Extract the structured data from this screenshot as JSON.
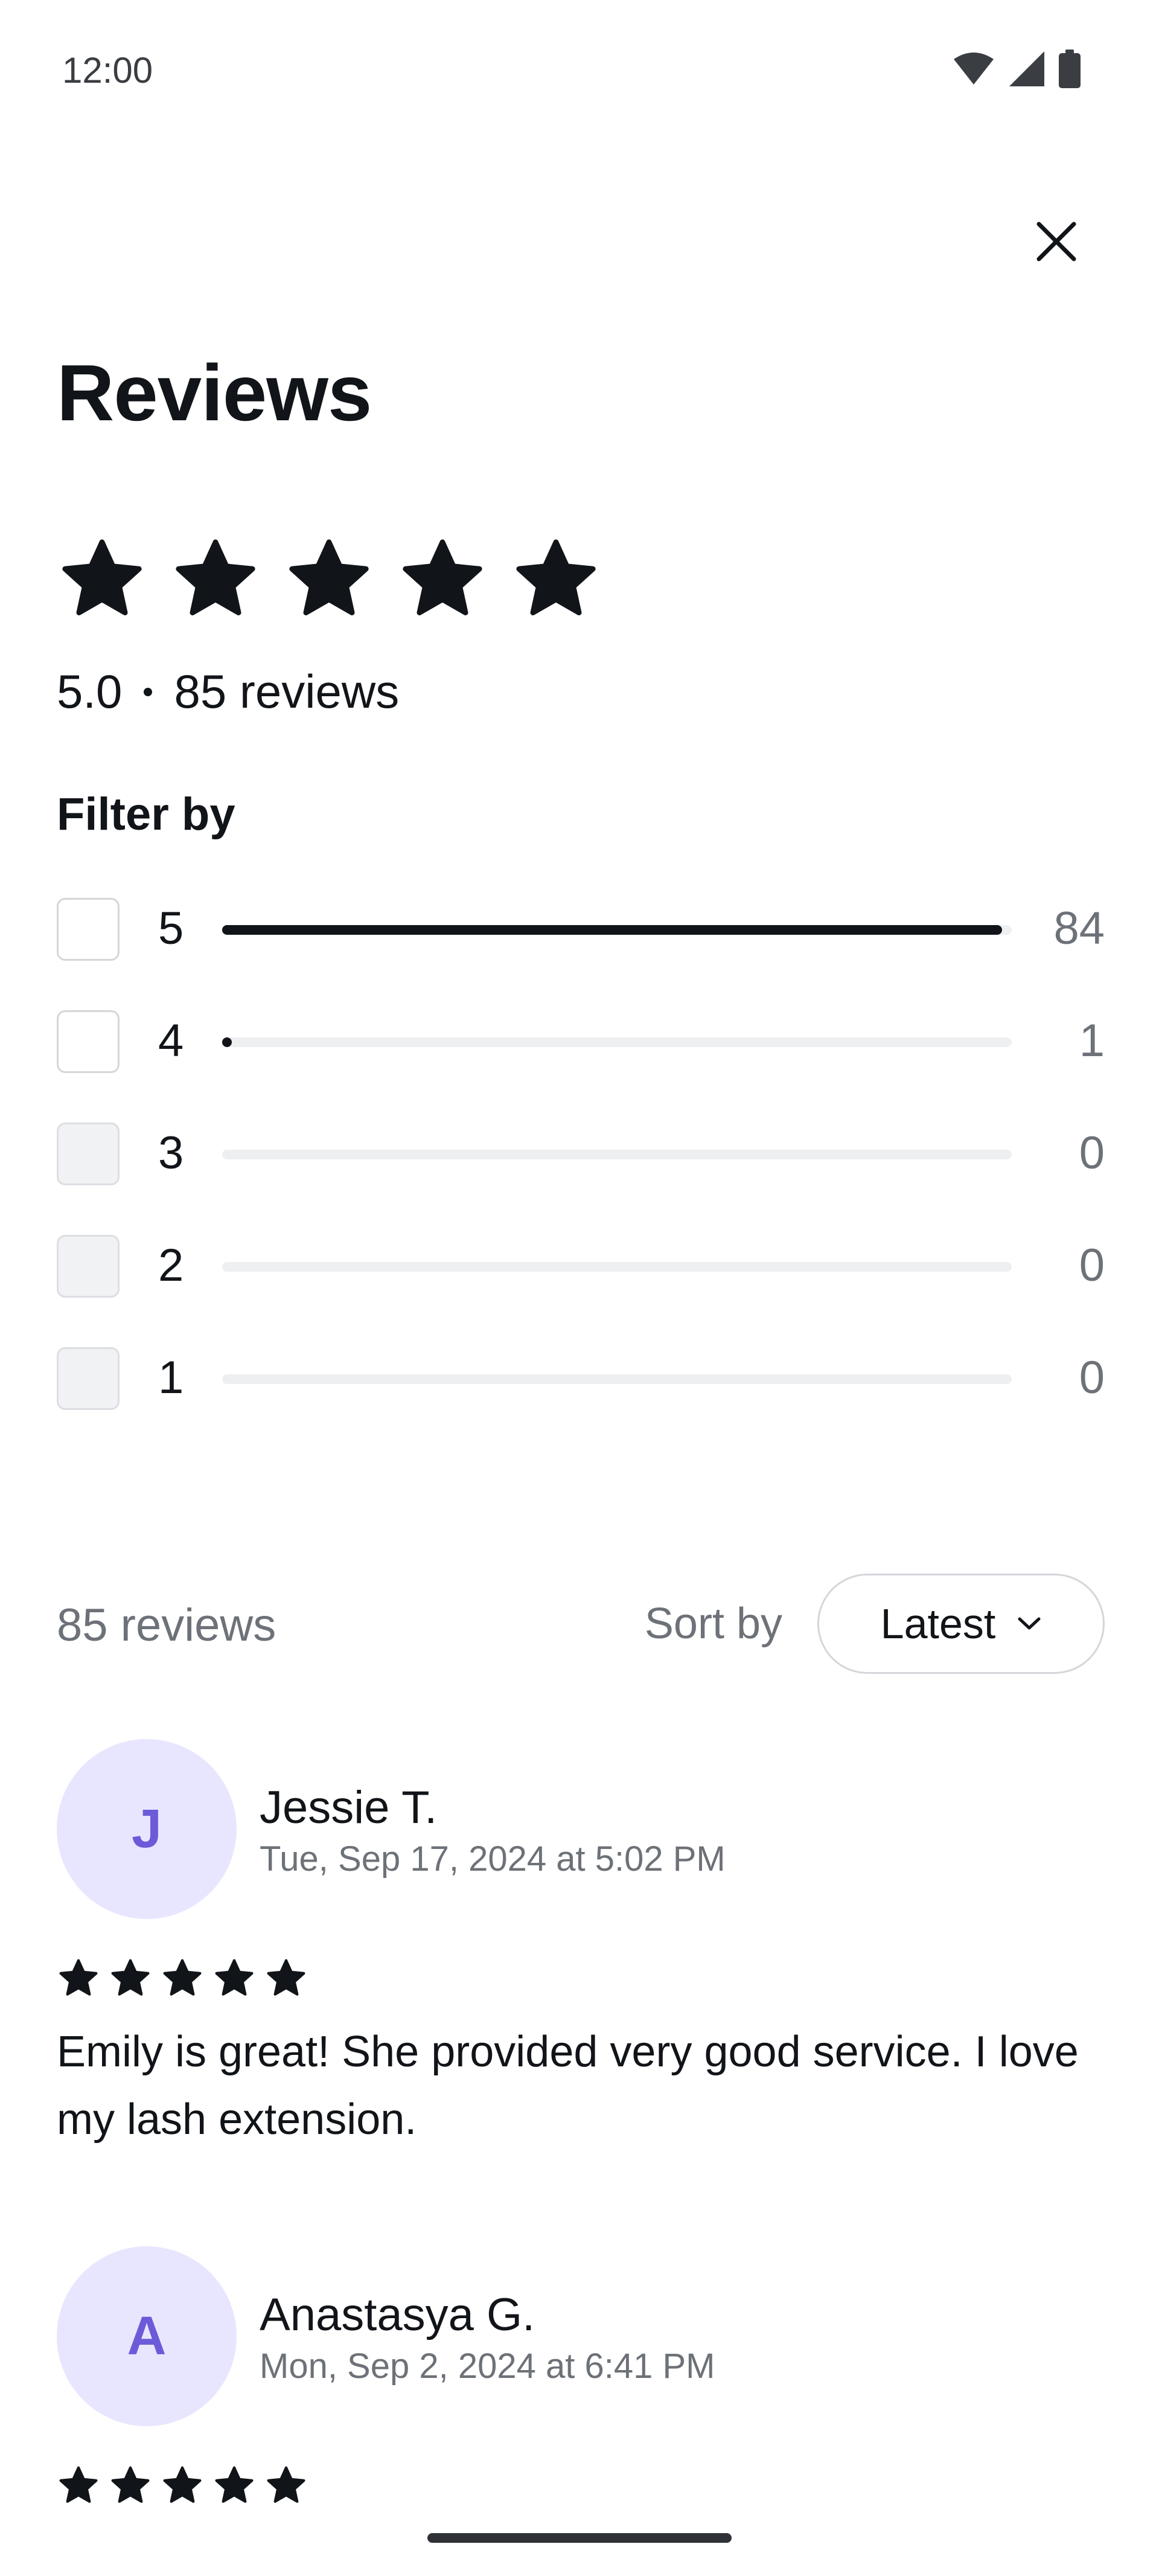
{
  "status_bar": {
    "time": "12:00",
    "icons": [
      "wifi-icon",
      "cellular-signal-icon",
      "battery-icon"
    ]
  },
  "header": {
    "close_icon": "close-icon",
    "title": "Reviews"
  },
  "summary": {
    "stars": 5,
    "rating": "5.0",
    "review_count": "85 reviews"
  },
  "filter": {
    "title": "Filter by",
    "rows": [
      {
        "label": "5",
        "count": "84",
        "fraction": 0.988,
        "enabled": true
      },
      {
        "label": "4",
        "count": "1",
        "fraction": 0.012,
        "enabled": true
      },
      {
        "label": "3",
        "count": "0",
        "fraction": 0,
        "enabled": false
      },
      {
        "label": "2",
        "count": "0",
        "fraction": 0,
        "enabled": false
      },
      {
        "label": "1",
        "count": "0",
        "fraction": 0,
        "enabled": false
      }
    ]
  },
  "reviews_header": {
    "count": "85 reviews",
    "sort_label": "Sort by",
    "sort_value": "Latest"
  },
  "reviews": [
    {
      "initial": "J",
      "name": "Jessie T.",
      "date": "Tue, Sep 17, 2024 at 5:02 PM",
      "stars": 5,
      "text": "Emily is great! She provided very good service. I love my lash extension."
    },
    {
      "initial": "A",
      "name": "Anastasya G.",
      "date": "Mon, Sep 2, 2024 at 6:41 PM",
      "stars": 5,
      "text": ""
    }
  ],
  "colors": {
    "text": "#111418",
    "muted": "#6d7178",
    "avatar_bg": "#e8e6ff",
    "avatar_text": "#6b5bd9",
    "bar_track": "#eeeff1"
  }
}
